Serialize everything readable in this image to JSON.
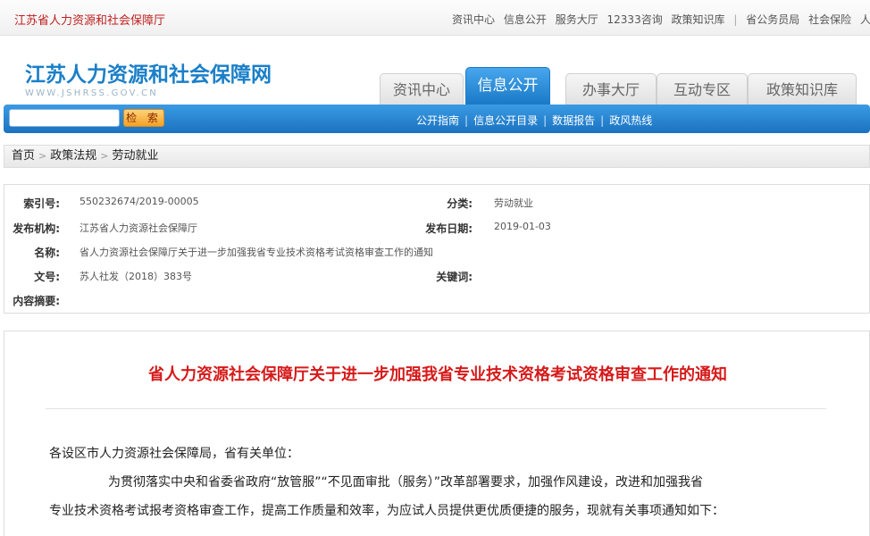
{
  "topbar": {
    "site_name": "江苏省人力资源和社会保障厅",
    "links": [
      "资讯中心",
      "信息公开",
      "服务大厅",
      "12333咨询",
      "政策知识库"
    ],
    "links_right": [
      "省公务员局",
      "社会保险",
      "人事人才"
    ]
  },
  "header": {
    "logo_title": "江苏人力资源和社会保障网",
    "logo_url": "WWW.JSHRSS.GOV.CN",
    "tabs": [
      "资讯中心",
      "信息公开",
      "办事大厅",
      "互动专区",
      "政策知识库"
    ],
    "active_tab": "信息公开"
  },
  "search": {
    "button_label": "检 索",
    "placeholder": ""
  },
  "subnav": [
    "公开指南",
    "信息公开目录",
    "数据报告",
    "政风热线"
  ],
  "breadcrumb": [
    "首页",
    "政策法规",
    "劳动就业"
  ],
  "meta": {
    "index_label": "索引号:",
    "index_value": "550232674/2019-00005",
    "category_label": "分类:",
    "category_value": "劳动就业",
    "publisher_label": "发布机构:",
    "publisher_value": "江苏省人力资源社会保障厅",
    "date_label": "发布日期:",
    "date_value": "2019-01-03",
    "name_label": "名称:",
    "name_value": "省人力资源社会保障厅关于进一步加强我省专业技术资格考试资格审查工作的通知",
    "docno_label": "文号:",
    "docno_value": "苏人社发（2018）383号",
    "keywords_label": "关键词:",
    "summary_label": "内容摘要:"
  },
  "article": {
    "title": "省人力资源社会保障厅关于进一步加强我省专业技术资格考试资格审查工作的通知",
    "salutation": "各设区市人力资源社会保障局，省有关单位：",
    "para1_line1": "为贯彻落实中央和省委省政府“放管服”“不见面审批（服务）”改革部署要求，加强作风建设，改进和加强我省",
    "para1_line2": "专业技术资格考试报考资格审查工作，提高工作质量和效率，为应试人员提供更优质便捷的服务，现就有关事项通知如下："
  },
  "colors": {
    "accent": "#1a7fc8",
    "title_red": "#d61a1a",
    "nav_blue": "#1b72c0"
  }
}
